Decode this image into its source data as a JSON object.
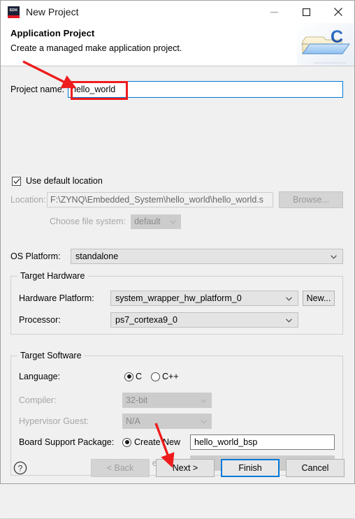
{
  "window": {
    "app_icon": "sdk-icon",
    "app_icon_text": "SDK",
    "title": "New Project",
    "minimize_label": "minimize-icon",
    "maximize_label": "maximize-icon",
    "close_label": "close-icon"
  },
  "banner": {
    "title": "Application Project",
    "subtitle": "Create a managed make application project.",
    "art": "c-project-folder-icon"
  },
  "form": {
    "project_name_label": "Project name:",
    "project_name_value": "hello_world",
    "use_default_location_label": "Use default location",
    "use_default_location_checked": true,
    "location_label": "Location:",
    "location_value": "F:\\ZYNQ\\Embedded_System\\hello_world\\hello_world.s",
    "browse_label": "Browse...",
    "choose_file_system_label": "Choose file system:",
    "choose_file_system_value": "default",
    "os_platform_label": "OS Platform:",
    "os_platform_value": "standalone"
  },
  "target_hardware": {
    "group_title": "Target Hardware",
    "hardware_platform_label": "Hardware Platform:",
    "hardware_platform_value": "system_wrapper_hw_platform_0",
    "new_button_label": "New...",
    "processor_label": "Processor:",
    "processor_value": "ps7_cortexa9_0"
  },
  "target_software": {
    "group_title": "Target Software",
    "language_label": "Language:",
    "language_options": [
      "C",
      "C++"
    ],
    "language_selected": "C",
    "compiler_label": "Compiler:",
    "compiler_value": "32-bit",
    "hypervisor_guest_label": "Hypervisor Guest:",
    "hypervisor_guest_value": "N/A",
    "bsp_label": "Board Support Package:",
    "bsp_create_new_label": "Create New",
    "bsp_create_new_value": "hello_world_bsp",
    "bsp_use_existing_label": "Use existing",
    "bsp_use_existing_value": "",
    "bsp_selected": "Create New"
  },
  "footer": {
    "help_label": "help-icon",
    "back_label": "< Back",
    "next_label": "Next >",
    "finish_label": "Finish",
    "cancel_label": "Cancel",
    "back_enabled": false,
    "default_button": "Finish"
  },
  "annotations": {
    "highlight_color": "#ee1c1c",
    "box_target": "project-name-value",
    "arrow_1_target": "project-name-input",
    "arrow_2_target": "next-button"
  },
  "colors": {
    "accent": "#0078d7",
    "dialog_bg": "#f0f0f0",
    "annotation_red": "#ee1c1c",
    "sdk_navy": "#1c2237",
    "sdk_red": "#e01a22"
  }
}
